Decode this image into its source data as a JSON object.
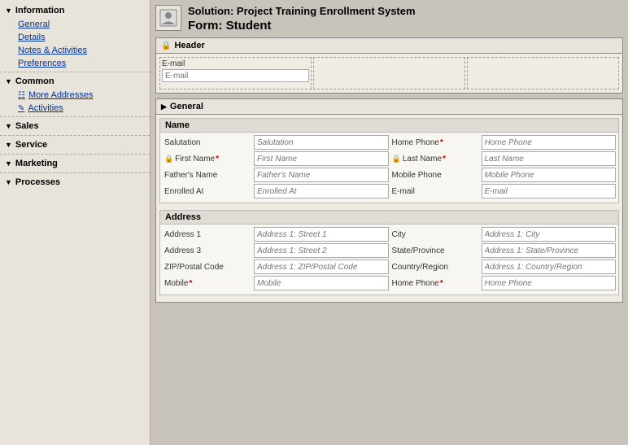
{
  "sidebar": {
    "sections": [
      {
        "id": "information",
        "label": "Information",
        "expanded": true,
        "items": [
          {
            "id": "general",
            "label": "General",
            "icon": ""
          },
          {
            "id": "details",
            "label": "Details",
            "icon": ""
          },
          {
            "id": "notes",
            "label": "Notes & Activities",
            "icon": ""
          },
          {
            "id": "preferences",
            "label": "Preferences",
            "icon": ""
          }
        ]
      },
      {
        "id": "common",
        "label": "Common",
        "expanded": true,
        "items": [
          {
            "id": "more-addresses",
            "label": "More Addresses",
            "icon": "grid"
          },
          {
            "id": "activities",
            "label": "Activities",
            "icon": "pencil"
          }
        ]
      },
      {
        "id": "sales",
        "label": "Sales",
        "expanded": false,
        "items": []
      },
      {
        "id": "service",
        "label": "Service",
        "expanded": false,
        "items": []
      },
      {
        "id": "marketing",
        "label": "Marketing",
        "expanded": false,
        "items": []
      },
      {
        "id": "processes",
        "label": "Processes",
        "expanded": false,
        "items": []
      }
    ]
  },
  "solution": {
    "title": "Solution: Project Training Enrollment System",
    "form_label": "Form:",
    "form_name": "Student"
  },
  "header_section": {
    "label": "Header",
    "locked": true,
    "cells": [
      {
        "field_label": "E-mail",
        "placeholder": "E-mail"
      },
      {
        "field_label": "",
        "placeholder": ""
      },
      {
        "field_label": "",
        "placeholder": ""
      }
    ]
  },
  "general_section": {
    "label": "General",
    "name_subsection": {
      "label": "Name",
      "rows": [
        [
          {
            "label": "Salutation",
            "placeholder": "Salutation",
            "required": false,
            "locked": false
          },
          {
            "label": "Home Phone",
            "placeholder": "Home Phone",
            "required": true,
            "locked": false
          }
        ],
        [
          {
            "label": "First Name",
            "placeholder": "First Name",
            "required": true,
            "locked": true
          },
          {
            "label": "Last Name",
            "placeholder": "Last Name",
            "required": true,
            "locked": true
          }
        ],
        [
          {
            "label": "Father's Name",
            "placeholder": "Father's Name",
            "required": false,
            "locked": false
          },
          {
            "label": "Mobile Phone",
            "placeholder": "Mobile Phone",
            "required": false,
            "locked": false
          }
        ],
        [
          {
            "label": "Enrolled At",
            "placeholder": "Enrolled At",
            "required": false,
            "locked": false
          },
          {
            "label": "E-mail",
            "placeholder": "E-mail",
            "required": false,
            "locked": false
          }
        ]
      ]
    },
    "address_subsection": {
      "label": "Address",
      "rows": [
        [
          {
            "label": "Address 1",
            "placeholder": "Address 1: Street 1",
            "required": false,
            "locked": false
          },
          {
            "label": "City",
            "placeholder": "Address 1: City",
            "required": false,
            "locked": false
          }
        ],
        [
          {
            "label": "Address 3",
            "placeholder": "Address 1: Street 2",
            "required": false,
            "locked": false
          },
          {
            "label": "State/Province",
            "placeholder": "Address 1: State/Province",
            "required": false,
            "locked": false
          }
        ],
        [
          {
            "label": "ZIP/Postal Code",
            "placeholder": "Address 1: ZIP/Postal Code",
            "required": false,
            "locked": false
          },
          {
            "label": "Country/Region",
            "placeholder": "Address 1: Country/Region",
            "required": false,
            "locked": false
          }
        ],
        [
          {
            "label": "Mobile",
            "placeholder": "Mobile",
            "required": true,
            "locked": false
          },
          {
            "label": "Home Phone",
            "placeholder": "Home Phone",
            "required": true,
            "locked": false
          }
        ]
      ]
    }
  }
}
